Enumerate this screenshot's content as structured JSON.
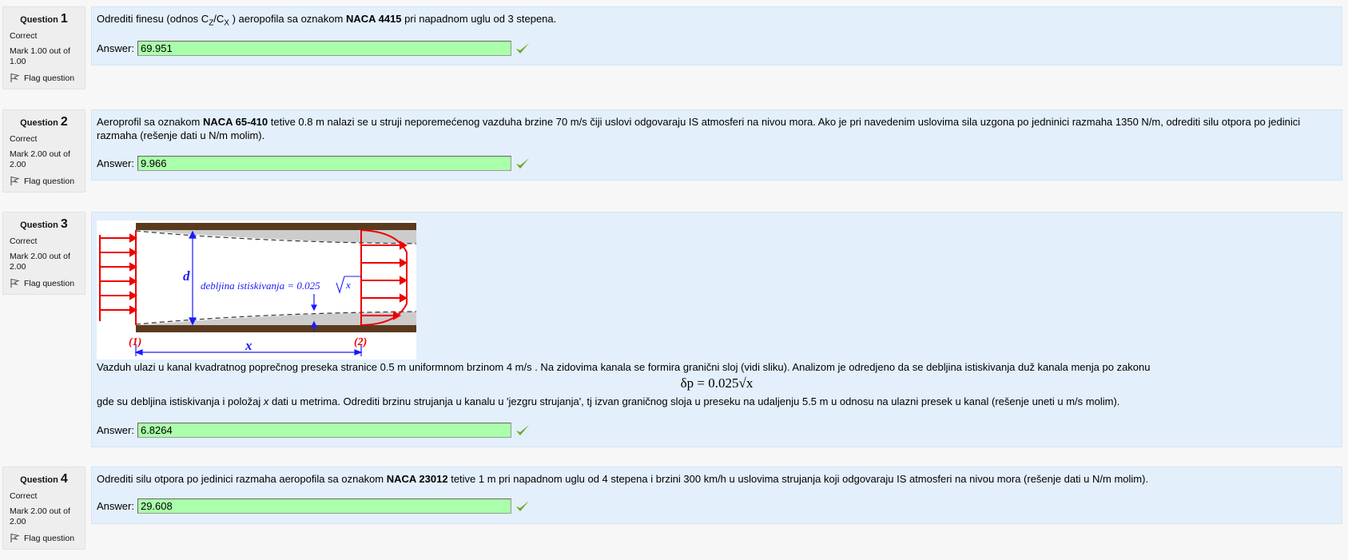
{
  "questions": [
    {
      "label": "Question",
      "number": "1",
      "state": "Correct",
      "grade": "Mark 1.00 out of 1.00",
      "flag": "Flag question",
      "answer_label": "Answer:",
      "answer": "69.951",
      "text": {
        "p1": "Odrediti finesu (odnos C",
        "sub1": "Z",
        "p2": "/C",
        "sub2": "X",
        "p3": " ) aeropofila sa oznakom ",
        "bold": "NACA 4415",
        "p4": " pri napadnom uglu od 3 stepena."
      }
    },
    {
      "label": "Question",
      "number": "2",
      "state": "Correct",
      "grade": "Mark 2.00 out of 2.00",
      "flag": "Flag question",
      "answer_label": "Answer:",
      "answer": "9.966",
      "text": {
        "p1": "Aeroprofil sa oznakom ",
        "bold": "NACA 65-410",
        "p2": " tetive 0.8 m nalazi se u struji neporemećenog vazduha brzine 70 m/s čiji uslovi odgovaraju IS atmosferi na nivou mora. Ako je pri navedenim uslovima sila uzgona po jedninici razmaha 1350 N/m, odrediti silu otpora po jedinici razmaha (rešenje dati u  N/m molim)."
      }
    },
    {
      "label": "Question",
      "number": "3",
      "state": "Correct",
      "grade": "Mark 2.00 out of 2.00",
      "flag": "Flag question",
      "answer_label": "Answer:",
      "answer": "6.8264",
      "text": {
        "line1": "Vazduh ulazi u kanal kvadratnog poprečnog preseka stranice 0.5 m uniformnom brzinom 4 m/s . Na zidovima kanala se formira granični sloj (vidi sliku). Analizom je odredjeno da se debljina istiskivanja duž kanala menja po zakonu",
        "formula": "δp = 0.025√x",
        "line2a": "gde su debljina istiskivanja i položaj ",
        "line2x": "x",
        "line2b": " dati u metrima. Odrediti brzinu strujanja u kanalu u 'jezgru strujanja', tj izvan graničnog sloja u preseku na udaljenju 5.5 m u odnosu na ulazni presek u kanal (rešenje uneti u m/s molim)."
      },
      "figure": {
        "d": "d",
        "x": "x",
        "s1": "(1)",
        "s2": "(2)",
        "eq": "debljina istiskivanja = 0.025",
        "eq_x": "x"
      }
    },
    {
      "label": "Question",
      "number": "4",
      "state": "Correct",
      "grade": "Mark 2.00 out of 2.00",
      "flag": "Flag question",
      "answer_label": "Answer:",
      "answer": "29.608",
      "text": {
        "p1": "Odrediti silu otpora po jedinici razmaha aeropofila sa oznakom ",
        "bold": "NACA 23012",
        "p2": " tetive 1 m pri napadnom uglu od 4 stepena i brzini 300 km/h u uslovima strujanja koji odgovaraju IS atmosferi na nivou mora (rešenje dati u N/m molim)."
      }
    }
  ],
  "colors": {
    "correct_field": "#aaffaa",
    "content_bg": "#e3effa",
    "info_bg": "#eeeeee",
    "check": "#6aaa1e"
  },
  "icons": {
    "flag": "flag-icon",
    "check": "check-icon"
  }
}
